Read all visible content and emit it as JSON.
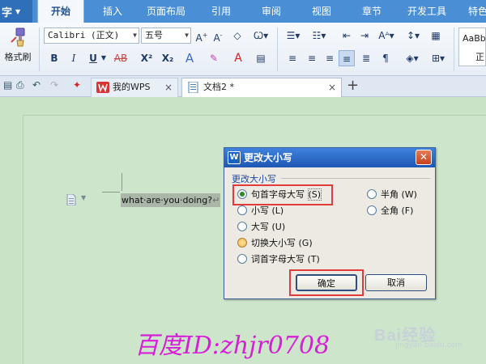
{
  "ribbon": {
    "app_button": "字",
    "tabs": [
      {
        "label": "开始",
        "active": true
      },
      {
        "label": "插入"
      },
      {
        "label": "页面布局"
      },
      {
        "label": "引用"
      },
      {
        "label": "审阅"
      },
      {
        "label": "视图"
      },
      {
        "label": "章节"
      },
      {
        "label": "开发工具"
      },
      {
        "label": "特色"
      }
    ],
    "format_painter": "格式刷",
    "font_name": "Calibri (正文)",
    "font_size": "五号",
    "bold": "B",
    "italic": "I",
    "underline": "U",
    "strike": "AB",
    "superscript": "X²",
    "subscript": "X₂",
    "style_preview_line1": "AaBb",
    "style_preview_line2": "正"
  },
  "doc_tabs": {
    "tabs": [
      {
        "label": "我的WPS"
      },
      {
        "label": "文档2 *",
        "active": true
      }
    ],
    "new_tab": "+"
  },
  "document": {
    "text": "what·are·you·doing?",
    "para_mark": "↵"
  },
  "dialog": {
    "title": "更改大小写",
    "close": "✕",
    "group_label": "更改大小写",
    "options_left": [
      {
        "label": "句首字母大写",
        "key": "(S)",
        "selected": true
      },
      {
        "label": "小写",
        "key": "(L)"
      },
      {
        "label": "大写",
        "key": "(U)"
      },
      {
        "label": "切换大小写",
        "key": "(G)"
      },
      {
        "label": "词首字母大写",
        "key": "(T)"
      }
    ],
    "options_right": [
      {
        "label": "半角",
        "key": "(W)"
      },
      {
        "label": "全角",
        "key": "(F)"
      }
    ],
    "ok": "确定",
    "cancel": "取消"
  },
  "watermark": "百度ID:zhjr0708",
  "brand": "Bai经验",
  "brand_url": "jingyan.baidu.com",
  "colors": {
    "accent": "#4a8fd6",
    "highlight_box": "#e23b3b",
    "watermark": "#d61fd6"
  }
}
